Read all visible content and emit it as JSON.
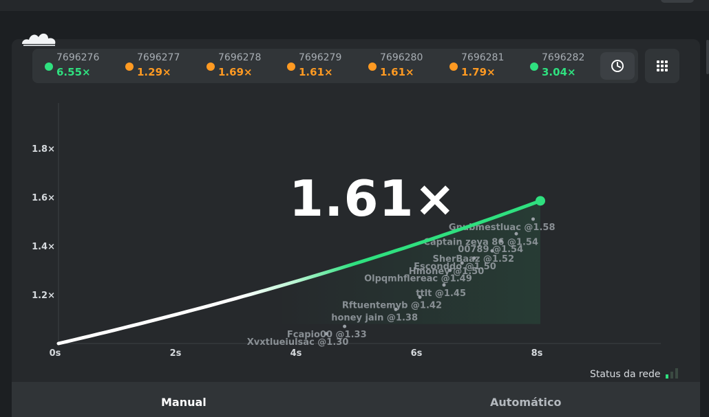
{
  "history": [
    {
      "id": "7696276",
      "mult": "6.55×",
      "color": "#2fe07f"
    },
    {
      "id": "7696277",
      "mult": "1.29×",
      "color": "#ff9a22"
    },
    {
      "id": "7696278",
      "mult": "1.69×",
      "color": "#ff9a22"
    },
    {
      "id": "7696279",
      "mult": "1.61×",
      "color": "#ff9a22"
    },
    {
      "id": "7696280",
      "mult": "1.61×",
      "color": "#ff9a22"
    },
    {
      "id": "7696281",
      "mult": "1.79×",
      "color": "#ff9a22"
    },
    {
      "id": "7696282",
      "mult": "3.04×",
      "color": "#2fe07f"
    }
  ],
  "current_multiplier": "1.61×",
  "status_label": "Status da rede",
  "tabs": {
    "manual": "Manual",
    "auto": "Automático"
  },
  "chart_data": {
    "type": "line",
    "x_ticks": [
      "0s",
      "2s",
      "4s",
      "6s",
      "8s"
    ],
    "y_ticks": [
      "1.2×",
      "1.4×",
      "1.6×",
      "1.8×"
    ],
    "xlim": [
      0,
      10
    ],
    "ylim": [
      1.0,
      2.0
    ],
    "curve_end": {
      "x": 8.0,
      "y": 1.585
    },
    "cashouts": [
      {
        "label": "Gnubmestluac @1.58",
        "x": 7.88,
        "y": 1.51
      },
      {
        "label": "Captain zeya 86 @1.54",
        "x": 7.6,
        "y": 1.45
      },
      {
        "label": "00789 @1.54",
        "x": 7.35,
        "y": 1.42
      },
      {
        "label": "SherBaaz @1.52",
        "x": 7.2,
        "y": 1.38
      },
      {
        "label": "Esconddo @1.50",
        "x": 6.9,
        "y": 1.35
      },
      {
        "label": "Hmoney @1.50",
        "x": 6.7,
        "y": 1.33
      },
      {
        "label": "Olpqmhflereac @1.49",
        "x": 6.5,
        "y": 1.3
      },
      {
        "label": "ttlt @1.45",
        "x": 6.4,
        "y": 1.24
      },
      {
        "label": "Rftuentemyb @1.42",
        "x": 6.0,
        "y": 1.19
      },
      {
        "label": "honey jain @1.38",
        "x": 5.6,
        "y": 1.14
      },
      {
        "label": "Fcapio00 @1.33",
        "x": 4.75,
        "y": 1.07
      },
      {
        "label": "Xvxtlueiulsac @1.30",
        "x": 4.45,
        "y": 1.04
      }
    ],
    "accent_color": "#2fe07f"
  }
}
